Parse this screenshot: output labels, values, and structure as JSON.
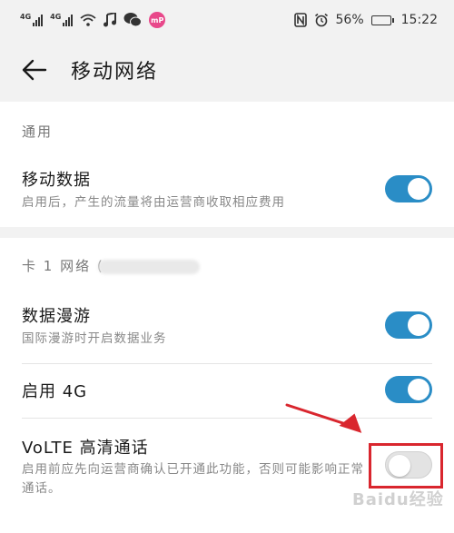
{
  "status_bar": {
    "net1": "4G",
    "net2": "4G",
    "battery_percent_text": "56%",
    "battery_level": 0.56,
    "time": "15:22",
    "mp_badge": "mP"
  },
  "header": {
    "title": "移动网络"
  },
  "general": {
    "section_label": "通用",
    "mobile_data": {
      "title": "移动数据",
      "subtitle": "启用后，产生的流量将由运营商收取相应费用",
      "enabled": true
    }
  },
  "sim1": {
    "section_label": "卡 1 网络 (",
    "data_roaming": {
      "title": "数据漫游",
      "subtitle": "国际漫游时开启数据业务",
      "enabled": true
    },
    "enable_4g": {
      "title": "启用 4G",
      "enabled": true
    },
    "volte": {
      "title": "VoLTE 高清通话",
      "subtitle": "启用前应先向运营商确认已开通此功能，否则可能影响正常通话。",
      "enabled": false
    }
  },
  "colors": {
    "switch_on": "#2a8dc6",
    "annotation_red": "#d9262e"
  },
  "watermark": "Baidu经验"
}
